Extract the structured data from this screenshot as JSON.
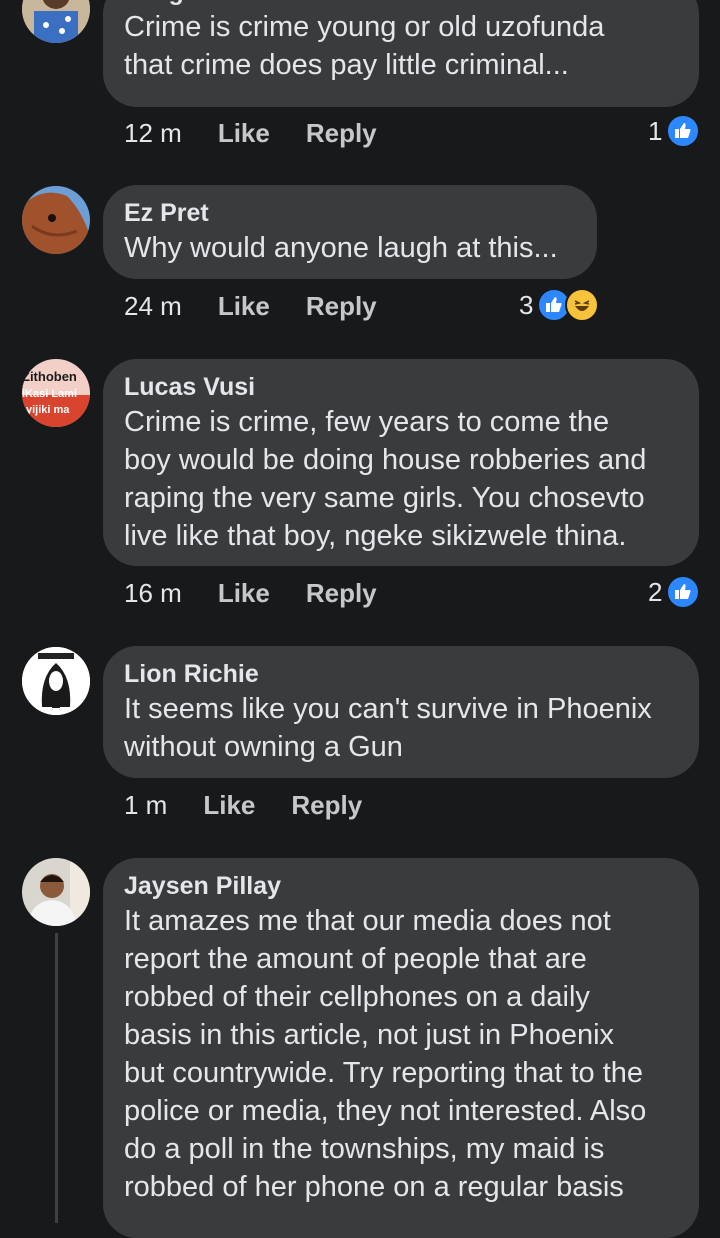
{
  "comments": [
    {
      "author": "Jongizizwe Modecai",
      "text": "Crime is crime young or old uzofunda\nthat crime does pay little criminal...",
      "time": "12 m",
      "like": "Like",
      "reply": "Reply",
      "reaction_count": "1"
    },
    {
      "author": "Ez Pret",
      "text": "Why would anyone laugh at this...",
      "time": "24 m",
      "like": "Like",
      "reply": "Reply",
      "reaction_count": "3"
    },
    {
      "author": "Lucas Vusi",
      "avatar_text": [
        "Zithoben",
        "iKasi Lami",
        "yijiki ma"
      ],
      "text": "Crime is crime, few years to come the\nboy would be doing house robberies and\nraping the very same girls. You chosevto\nlive like that boy, ngeke sikizwele thina.",
      "time": "16 m",
      "like": "Like",
      "reply": "Reply",
      "reaction_count": "2"
    },
    {
      "author": "Lion Richie",
      "text": "It seems like you can't survive in Phoenix\nwithout owning a Gun",
      "time": "1 m",
      "like": "Like",
      "reply": "Reply"
    },
    {
      "author": "Jaysen Pillay",
      "text": "It amazes me that our media does not\nreport the amount of people that are\nrobbed of their cellphones on a daily\nbasis in this article, not just in Phoenix\nbut countrywide. Try reporting that to the\npolice or media, they not interested. Also\ndo a poll in the townships, my maid is\nrobbed of her phone on a regular basis"
    }
  ],
  "colors": {
    "background": "#18191a",
    "bubble": "#3a3b3c",
    "like_blue": "#2d88ff",
    "haha_yellow": "#f7c33a"
  }
}
